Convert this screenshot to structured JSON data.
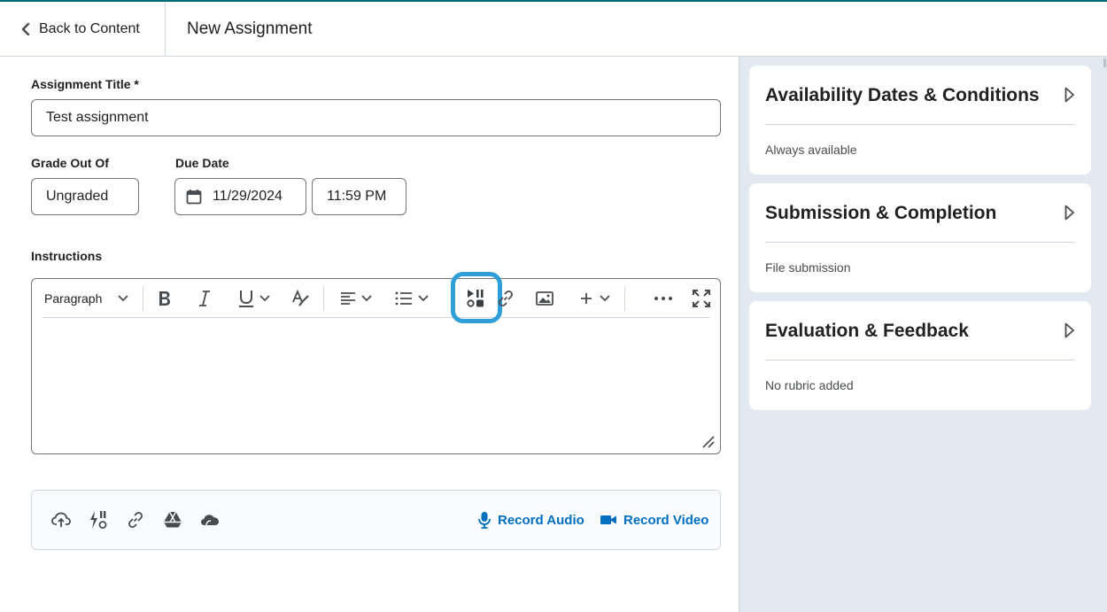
{
  "header": {
    "back_label": "Back to Content",
    "title": "New Assignment"
  },
  "form": {
    "title_label": "Assignment Title *",
    "title_value": "Test assignment",
    "grade_label": "Grade Out Of",
    "grade_value": "Ungraded",
    "due_label": "Due Date",
    "due_date": "11/29/2024",
    "due_time": "11:59 PM",
    "instructions_label": "Instructions"
  },
  "toolbar": {
    "paragraph": "Paragraph"
  },
  "attachments": {
    "record_audio": "Record Audio",
    "record_video": "Record Video"
  },
  "sidebar": {
    "cards": [
      {
        "title": "Availability Dates & Conditions",
        "sub": "Always available"
      },
      {
        "title": "Submission & Completion",
        "sub": "File submission"
      },
      {
        "title": "Evaluation & Feedback",
        "sub": "No rubric added"
      }
    ]
  },
  "colors": {
    "accent": "#006fbf",
    "highlight": "#2f9ed8",
    "sidebar_bg": "#e3e9f1"
  }
}
